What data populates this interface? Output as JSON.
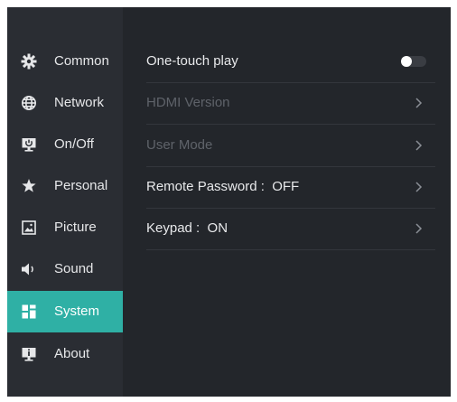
{
  "sidebar": {
    "items": [
      {
        "label": "Common",
        "icon": "gear-icon"
      },
      {
        "label": "Network",
        "icon": "globe-icon"
      },
      {
        "label": "On/Off",
        "icon": "power-monitor-icon"
      },
      {
        "label": "Personal",
        "icon": "star-icon"
      },
      {
        "label": "Picture",
        "icon": "picture-icon"
      },
      {
        "label": "Sound",
        "icon": "speaker-icon"
      },
      {
        "label": "System",
        "icon": "system-grid-icon",
        "active": true
      },
      {
        "label": "About",
        "icon": "info-monitor-icon"
      }
    ]
  },
  "settings": {
    "one_touch_play": {
      "label": "One-touch play",
      "enabled": false
    },
    "hdmi_version": {
      "label": "HDMI Version",
      "disabled": true
    },
    "user_mode": {
      "label": "User Mode",
      "disabled": true
    },
    "remote_password": {
      "label": "Remote Password :  OFF"
    },
    "keypad": {
      "label": "Keypad :  ON"
    }
  },
  "colors": {
    "background": "#23262b",
    "sidebar": "#2a2d33",
    "accent": "#2fb0a5",
    "text": "#e8e9eb",
    "disabled_text": "#5f636a"
  }
}
